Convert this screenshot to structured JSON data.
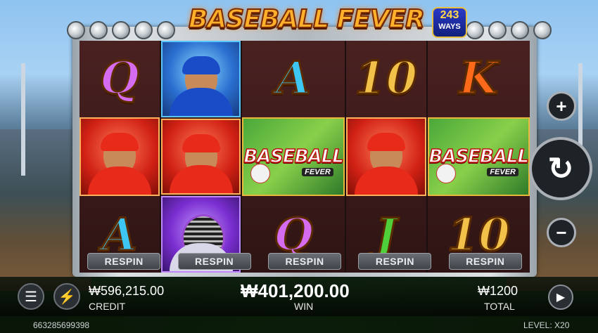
{
  "game": {
    "title": "BASEBALL FEVER",
    "ways_count": "243",
    "ways_label": "WAYS"
  },
  "reels": [
    [
      {
        "type": "letter",
        "text": "Q",
        "color": "#d56cf0"
      },
      {
        "type": "batter"
      },
      {
        "type": "letter",
        "text": "A",
        "color": "#3ec6f2"
      }
    ],
    [
      {
        "type": "pitcher"
      },
      {
        "type": "batter"
      },
      {
        "type": "catcher"
      }
    ],
    [
      {
        "type": "letter",
        "text": "A",
        "color": "#3ec6f2"
      },
      {
        "type": "wild",
        "text": "BASEBALL",
        "sub": "FEVER"
      },
      {
        "type": "letter",
        "text": "Q",
        "color": "#d56cf0"
      }
    ],
    [
      {
        "type": "letter",
        "text": "10",
        "color": "#f2c14a"
      },
      {
        "type": "batter"
      },
      {
        "type": "letter",
        "text": "J",
        "color": "#4fcf3a"
      }
    ],
    [
      {
        "type": "letter",
        "text": "K",
        "color": "#ff6a1a"
      },
      {
        "type": "wild",
        "text": "BASEBALL",
        "sub": "FEVER"
      },
      {
        "type": "letter",
        "text": "10",
        "color": "#f2c14a"
      }
    ]
  ],
  "respin_label": "RESPIN",
  "controls": {
    "plus": "+",
    "minus": "−",
    "spin": "↻"
  },
  "status": {
    "credit_value": "₩596,215.00",
    "credit_label": "CREDIT",
    "win_value": "₩401,200.00",
    "win_label": "WIN",
    "total_value": "₩1200",
    "total_label": "TOTAL"
  },
  "footer": {
    "round_id": "663285699398",
    "level": "LEVEL: X20"
  }
}
